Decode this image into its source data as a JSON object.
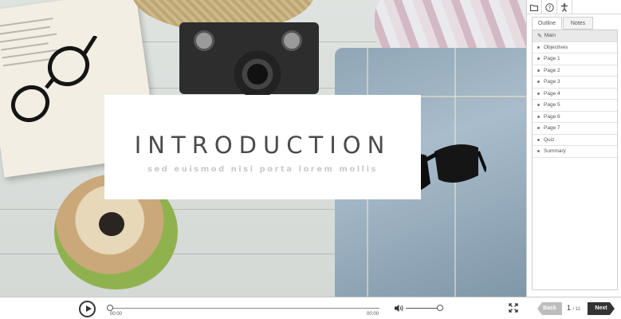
{
  "slide": {
    "title": "INTRODUCTION",
    "subtitle": "sed euismod nisi porta lorem mollis"
  },
  "toolbar": {
    "icons": [
      "folder-icon",
      "help-icon",
      "accessibility-icon"
    ]
  },
  "tabs": [
    {
      "label": "Outline",
      "active": true
    },
    {
      "label": "Notes",
      "active": false
    }
  ],
  "outline": {
    "items": [
      {
        "label": "Main",
        "active": true
      },
      {
        "label": "Objectives"
      },
      {
        "label": "Page 1"
      },
      {
        "label": "Page 2"
      },
      {
        "label": "Page 3"
      },
      {
        "label": "Page 4"
      },
      {
        "label": "Page 5"
      },
      {
        "label": "Page 6"
      },
      {
        "label": "Page 7"
      },
      {
        "label": "Quiz"
      },
      {
        "label": "Summary"
      }
    ]
  },
  "player": {
    "time_current": "00:00",
    "time_total": "00:00",
    "back_label": "Back",
    "next_label": "Next",
    "page_current": "1",
    "page_total": "/ 11"
  }
}
